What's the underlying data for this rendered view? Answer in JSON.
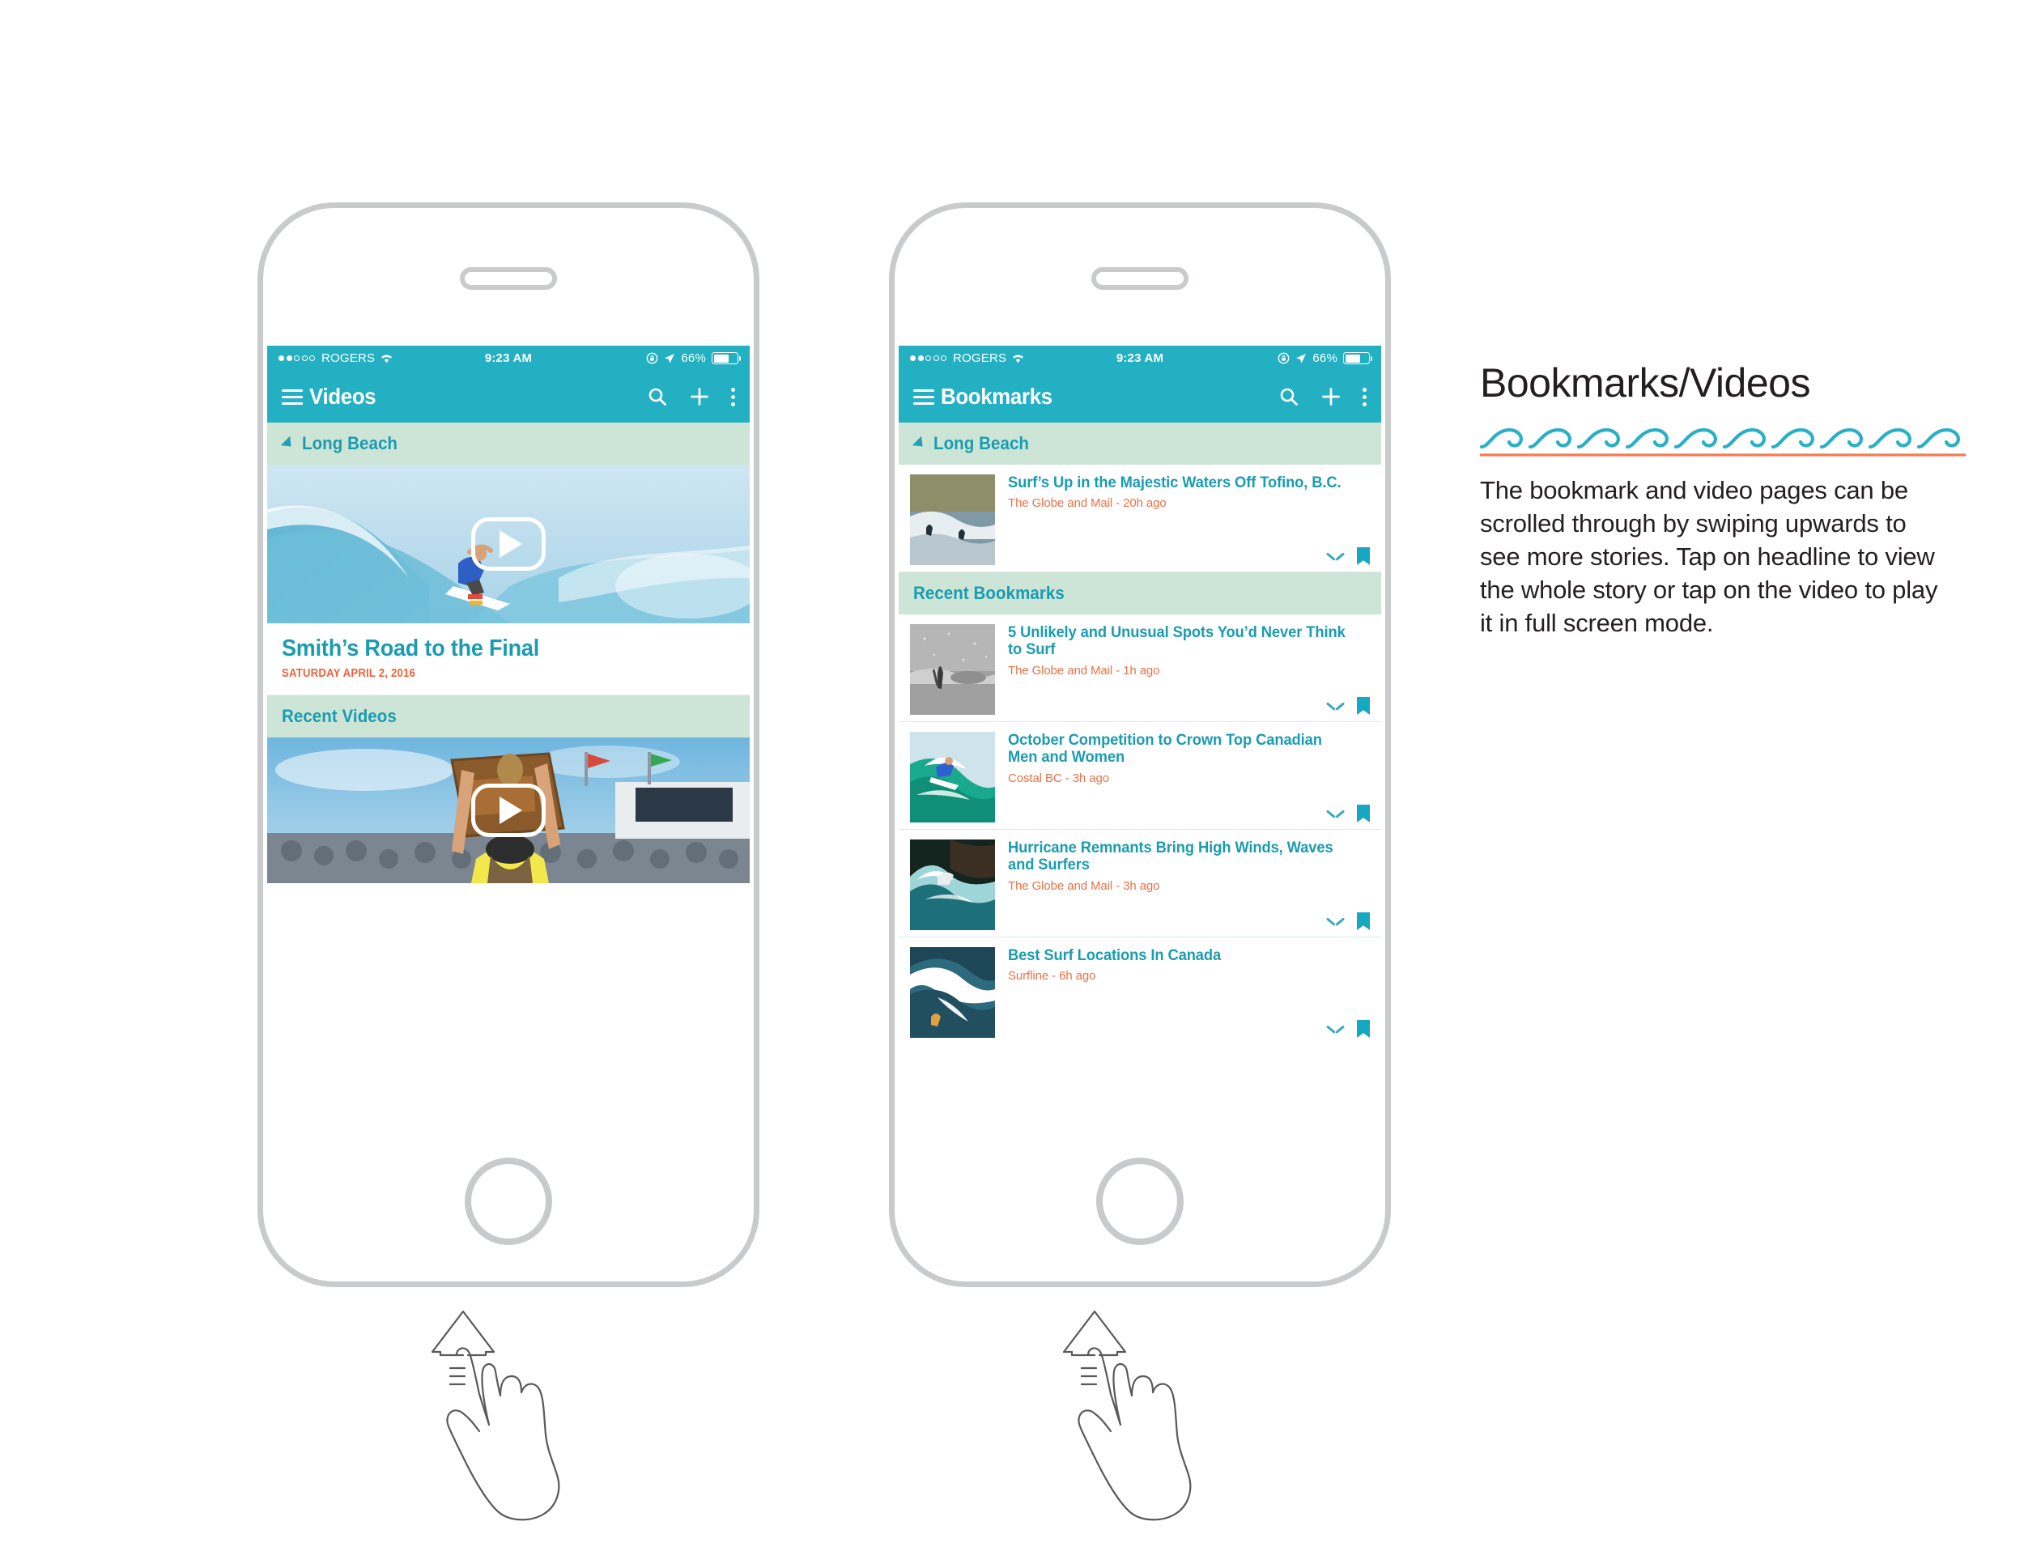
{
  "status_bar": {
    "carrier": "ROGERS",
    "time": "9:23 AM",
    "battery_percent": "66%",
    "signal_dots_filled": 2,
    "signal_dots_total": 5,
    "icons": [
      "wifi-icon",
      "rotation-lock-icon",
      "location-arrow-icon",
      "battery-icon"
    ]
  },
  "phones": [
    {
      "id": "videos-phone",
      "app_bar": {
        "title": "Videos",
        "menu_icon": "hamburger-icon",
        "actions": [
          "search-icon",
          "plus-icon",
          "overflow-menu-icon"
        ]
      },
      "section_location": "Long Beach",
      "featured_video": {
        "headline": "Smith’s Road to the Final",
        "date": "SATURDAY APRIL 2, 2016",
        "play_label": "play-button"
      },
      "section_recent": "Recent Videos"
    },
    {
      "id": "bookmarks-phone",
      "app_bar": {
        "title": "Bookmarks",
        "menu_icon": "hamburger-icon",
        "actions": [
          "search-icon",
          "plus-icon",
          "overflow-menu-icon"
        ]
      },
      "section_location": "Long Beach",
      "section_recent": "Recent Bookmarks",
      "pinned_item": {
        "title": "Surf’s Up in the Majestic Waters Off Tofino, B.C.",
        "meta": "The Globe and Mail - 20h ago"
      },
      "items": [
        {
          "title": "5 Unlikely and Unusual Spots You’d Never Think to Surf",
          "meta": "The Globe and Mail - 1h ago"
        },
        {
          "title": "October Competition to Crown Top Canadian Men and Women",
          "meta": "Costal BC - 3h ago"
        },
        {
          "title": "Hurricane Remnants Bring High Winds, Waves and Surfers",
          "meta": "The Globe and Mail - 3h ago"
        },
        {
          "title": "Best Surf Locations In Canada",
          "meta": "Surfline - 6h ago"
        }
      ]
    }
  ],
  "annotation": {
    "title": "Bookmarks/Videos",
    "body": "The bookmark and video pages can be scrolled through by swiping upwards to see more stories. Tap on headline to view the whole story or tap on the video to play it in full screen mode."
  },
  "gesture": {
    "name": "swipe-up-gesture",
    "count": 2
  },
  "colors": {
    "teal": "#22b0c2",
    "teal_text": "#1a9cb0",
    "mint_band": "#cde5d7",
    "orange": "#ee7046",
    "orange_rule": "#f47a52",
    "frame_gray": "#c9cacb",
    "text_dark": "#231f20"
  }
}
